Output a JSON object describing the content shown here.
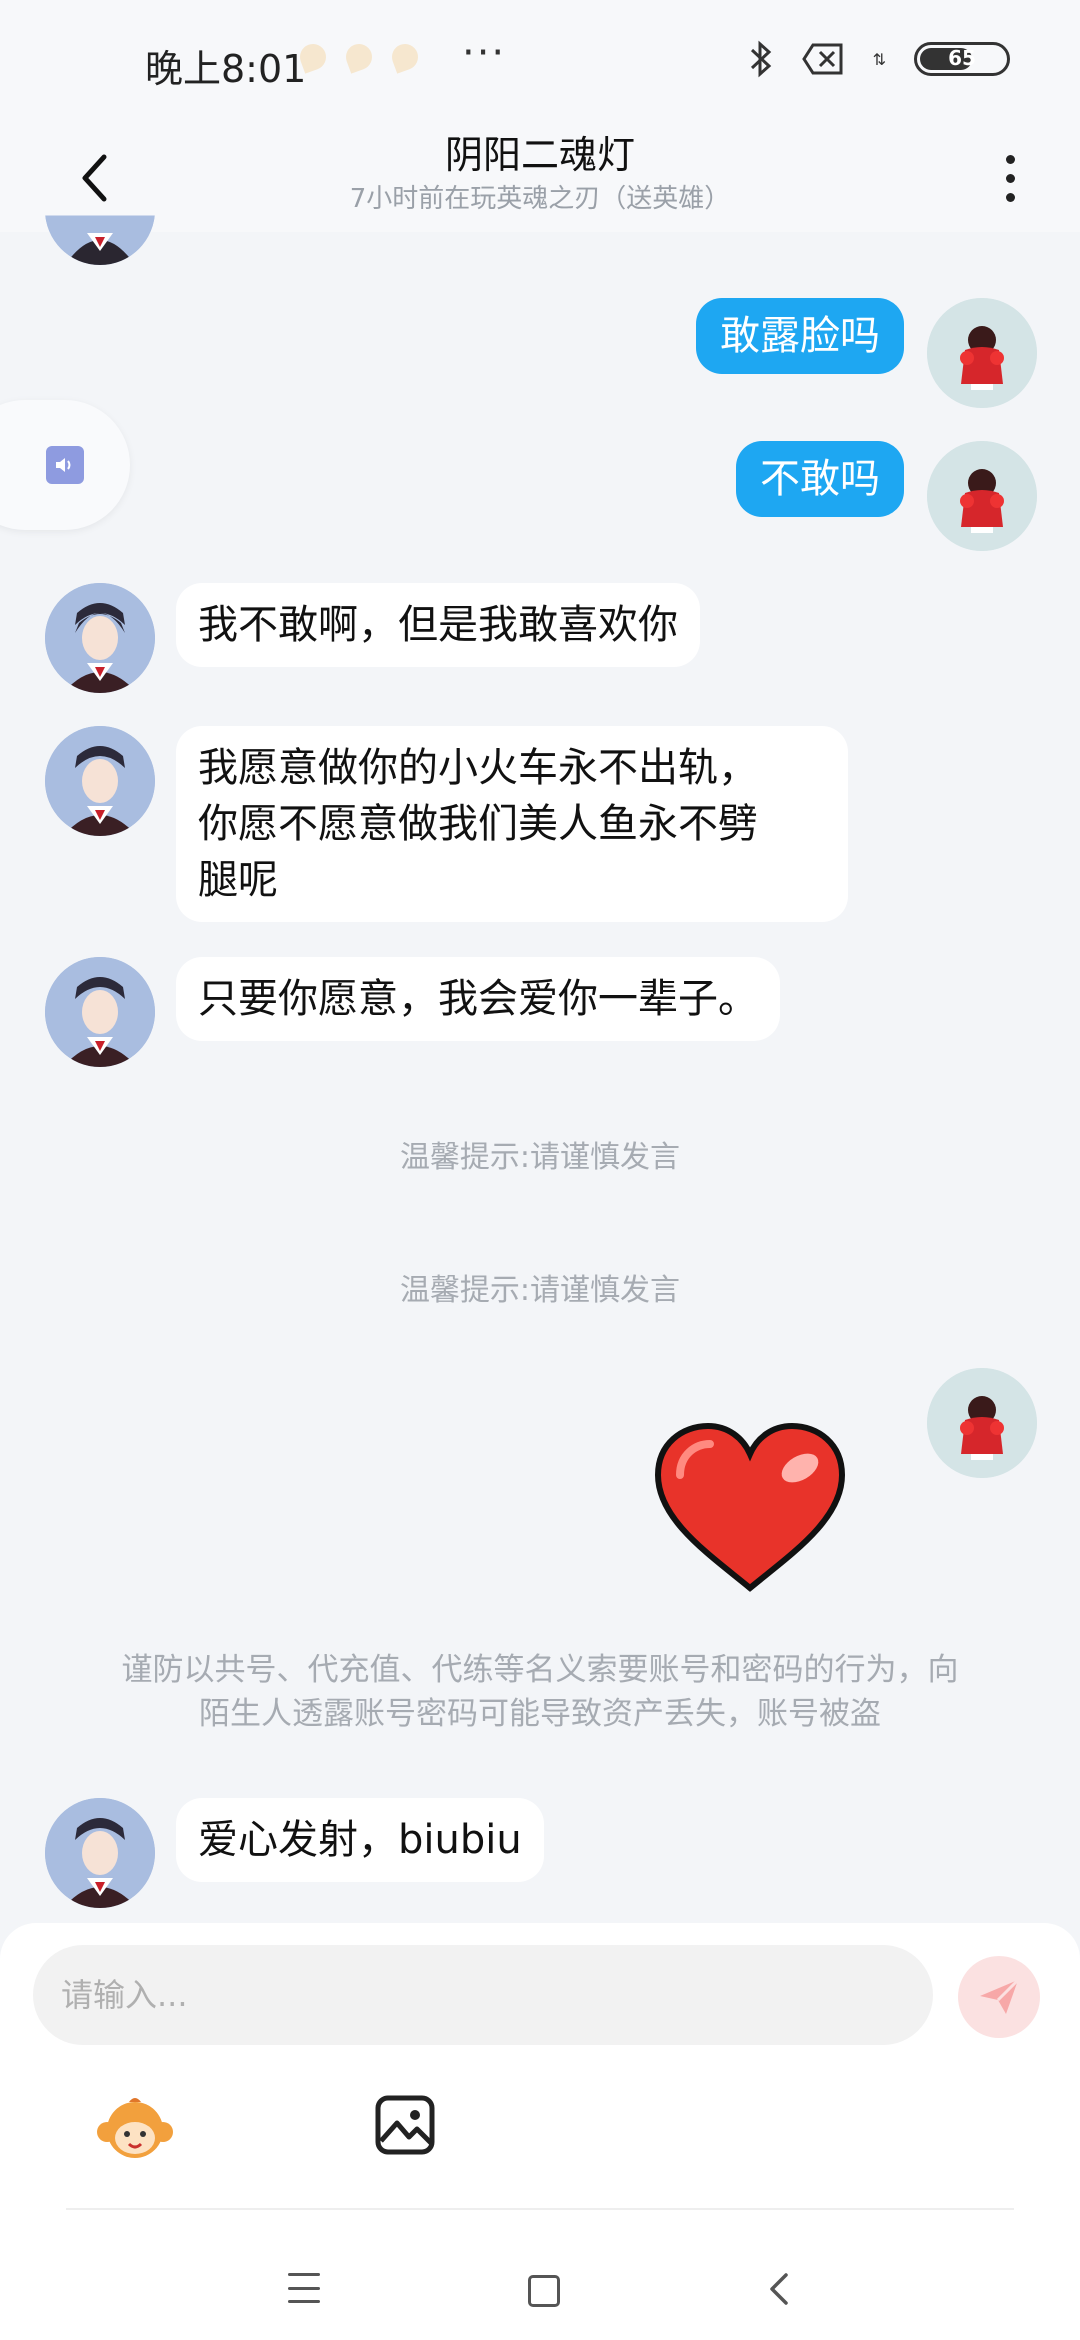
{
  "status_bar": {
    "time": "晚上8:01",
    "more": "···",
    "battery": "65",
    "battery_level": 0.65
  },
  "header": {
    "title": "阴阳二魂灯",
    "subtitle": "7小时前在玩英魂之刃（送英雄）"
  },
  "messages": {
    "m1": "敢露脸吗",
    "m2": "不敢吗",
    "m3": "我不敢啊，但是我敢喜欢你",
    "m4_line1": "我愿意做你的小火车永不出轨，",
    "m4_line2": "你愿不愿意做我们美人鱼永不劈",
    "m4_line3": "腿呢",
    "m5": "只要你愿意，我会爱你一辈子。",
    "sys1": "温馨提示:请谨慎发言",
    "sys2": "温馨提示:请谨慎发言",
    "warning_line1": "谨防以共号、代充值、代练等名义索要账号和密码的行为，向",
    "warning_line2": "陌生人透露账号密码可能导致资产丢失，账号被盗",
    "m6": "爱心发射，biubiu"
  },
  "composer": {
    "placeholder": "请输入..."
  },
  "colors": {
    "self_bubble": "#1ea7f2",
    "other_bubble": "#ffffff",
    "background": "#f3f5f8",
    "send_button": "#fbe1e1"
  },
  "icons": {
    "back": "chevron-left-icon",
    "more": "more-vertical-icon",
    "send": "send-icon",
    "emoji": "monkey-emoji-icon",
    "image": "image-icon",
    "audio": "speaker-icon",
    "heart": "heart-sticker-icon",
    "bluetooth": "bluetooth-icon"
  }
}
